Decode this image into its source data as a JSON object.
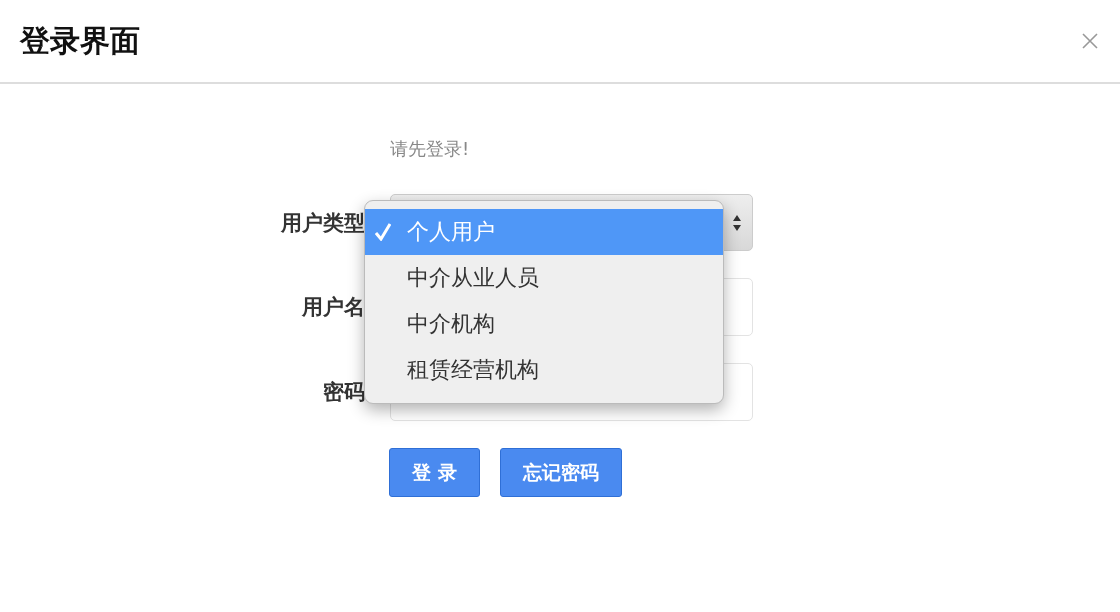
{
  "dialog": {
    "title": "登录界面"
  },
  "prompt": "请先登录!",
  "fields": [
    {
      "kind": "select",
      "label": "用户类型",
      "options": [
        {
          "label": "个人用户",
          "selected": true
        },
        {
          "label": "中介从业人员",
          "selected": false
        },
        {
          "label": "中介机构",
          "selected": false
        },
        {
          "label": "租赁经营机构",
          "selected": false
        }
      ]
    },
    {
      "kind": "text",
      "label": "用户名"
    },
    {
      "kind": "password",
      "label": "密码"
    }
  ],
  "buttons": [
    {
      "label": "登 录"
    },
    {
      "label": "忘记密码"
    }
  ]
}
